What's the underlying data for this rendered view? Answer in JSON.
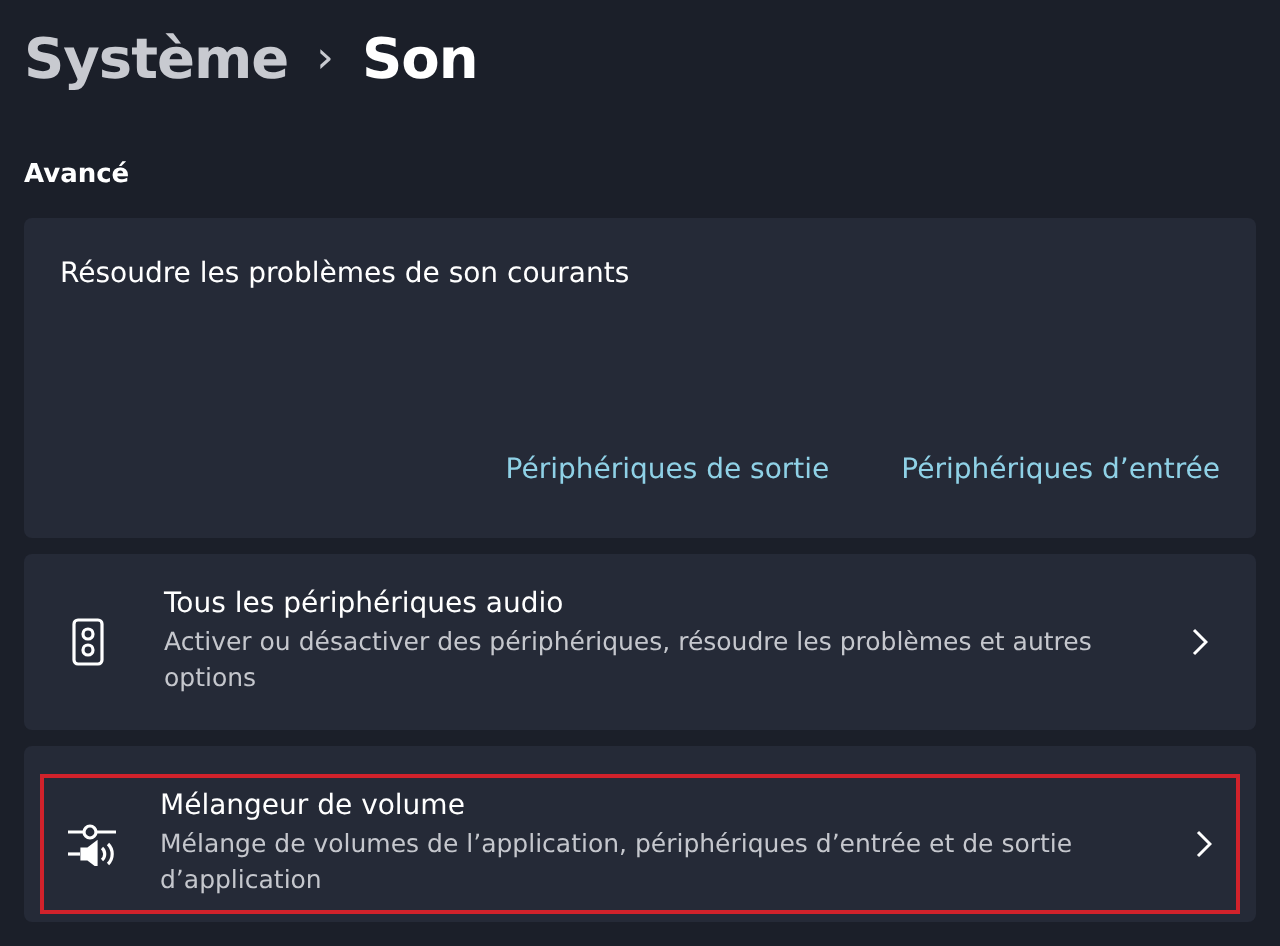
{
  "breadcrumb": {
    "parent": "Système",
    "separator": "›",
    "current": "Son"
  },
  "section_title": "Avancé",
  "troubleshoot": {
    "title": "Résoudre les problèmes de son courants",
    "links": [
      "Périphériques de sortie",
      "Périphériques d’entrée"
    ]
  },
  "items": [
    {
      "kind": "speaker",
      "title": "Tous les périphériques audio",
      "description": "Activer ou désactiver des périphériques, résoudre les problèmes et autres options",
      "highlighted": false
    },
    {
      "kind": "mixer",
      "title": "Mélangeur de volume",
      "description": "Mélange de volumes de l’application, périphériques d’entrée et de sortie d’application",
      "highlighted": true
    }
  ]
}
